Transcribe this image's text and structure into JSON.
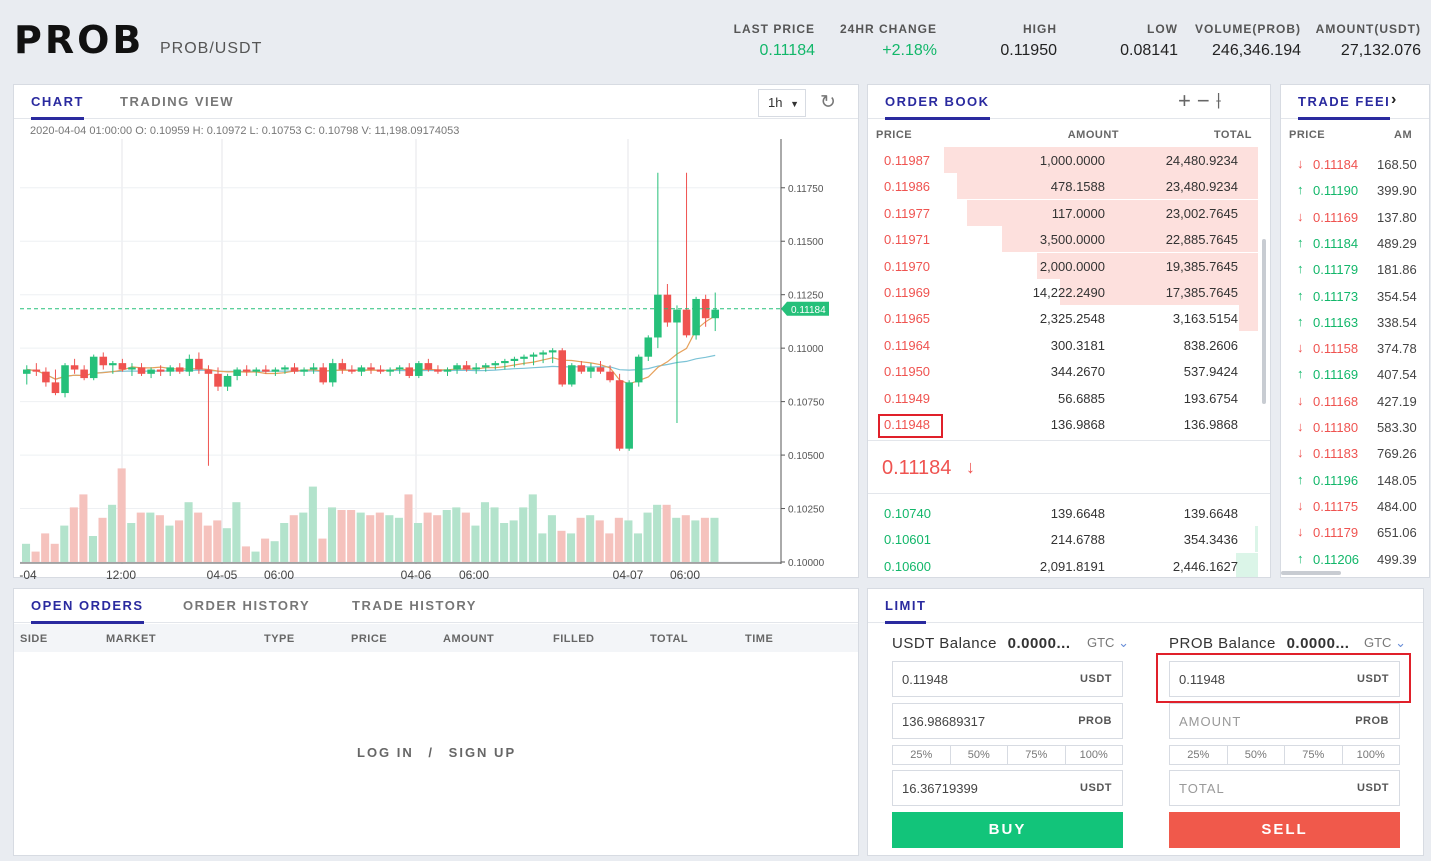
{
  "header": {
    "logo": "PROB",
    "pair": "PROB/USDT",
    "stats": [
      {
        "label": "LAST PRICE",
        "value": "0.11184"
      },
      {
        "label": "24HR CHANGE",
        "value": "+2.18%"
      },
      {
        "label": "HIGH",
        "value": "0.11950"
      },
      {
        "label": "LOW",
        "value": "0.08141"
      },
      {
        "label": "VOLUME(PROB)",
        "value": "246,346.194"
      },
      {
        "label": "AMOUNT(USDT)",
        "value": "27,132.076"
      }
    ]
  },
  "chart_panel": {
    "tabs": [
      "CHART",
      "TRADING VIEW"
    ],
    "interval": "1h",
    "info": "2020-04-04 01:00:00  O: 0.10959  H: 0.10972  L: 0.10753  C: 0.10798  V: 11,198.09174053",
    "price_tag": "0.11184",
    "y_ticks": [
      "0.11750",
      "0.11500",
      "0.11250",
      "0.11000",
      "0.10750",
      "0.10500",
      "0.10250",
      "0.10000"
    ],
    "x_ticks": [
      "-04",
      "12:00",
      "04-05",
      "06:00",
      "04-06",
      "06:00",
      "04-07",
      "06:00"
    ]
  },
  "chart_data": {
    "type": "candlestick",
    "ylim": [
      0.1,
      0.1195
    ],
    "last_price": 0.11184,
    "candles": [
      [
        0.1088,
        0.1092,
        0.1083,
        0.109
      ],
      [
        0.109,
        0.1093,
        0.1087,
        0.1089
      ],
      [
        0.1089,
        0.1091,
        0.1082,
        0.1084
      ],
      [
        0.1084,
        0.109,
        0.1078,
        0.1079
      ],
      [
        0.1079,
        0.1093,
        0.1077,
        0.1092
      ],
      [
        0.1092,
        0.1095,
        0.1088,
        0.109
      ],
      [
        0.109,
        0.1092,
        0.1085,
        0.1086
      ],
      [
        0.1086,
        0.1097,
        0.1085,
        0.1096
      ],
      [
        0.1096,
        0.1098,
        0.109,
        0.1092
      ],
      [
        0.1092,
        0.1094,
        0.1088,
        0.1093
      ],
      [
        0.1093,
        0.1095,
        0.1089,
        0.109
      ],
      [
        0.109,
        0.1093,
        0.1087,
        0.1091
      ],
      [
        0.1091,
        0.1093,
        0.1087,
        0.1088
      ],
      [
        0.1088,
        0.1091,
        0.1086,
        0.109
      ],
      [
        0.109,
        0.1092,
        0.1087,
        0.1089
      ],
      [
        0.1089,
        0.1092,
        0.1087,
        0.1091
      ],
      [
        0.1091,
        0.1093,
        0.1088,
        0.1089
      ],
      [
        0.1089,
        0.1097,
        0.1087,
        0.1095
      ],
      [
        0.1095,
        0.1098,
        0.1088,
        0.109
      ],
      [
        0.109,
        0.1092,
        0.1045,
        0.1088
      ],
      [
        0.1088,
        0.1091,
        0.108,
        0.1082
      ],
      [
        0.1082,
        0.1088,
        0.108,
        0.1087
      ],
      [
        0.1087,
        0.1091,
        0.1085,
        0.109
      ],
      [
        0.109,
        0.1092,
        0.1087,
        0.1089
      ],
      [
        0.1089,
        0.1091,
        0.1087,
        0.109
      ],
      [
        0.109,
        0.1092,
        0.1088,
        0.1089
      ],
      [
        0.1089,
        0.1091,
        0.1087,
        0.109
      ],
      [
        0.109,
        0.1092,
        0.1088,
        0.1091
      ],
      [
        0.1091,
        0.1093,
        0.1088,
        0.1089
      ],
      [
        0.1089,
        0.1091,
        0.1087,
        0.109
      ],
      [
        0.109,
        0.1093,
        0.1088,
        0.1091
      ],
      [
        0.1091,
        0.1093,
        0.1083,
        0.1084
      ],
      [
        0.1084,
        0.1095,
        0.1082,
        0.1093
      ],
      [
        0.1093,
        0.1095,
        0.1088,
        0.109
      ],
      [
        0.109,
        0.1092,
        0.1088,
        0.1089
      ],
      [
        0.1089,
        0.1092,
        0.1087,
        0.1091
      ],
      [
        0.1091,
        0.1093,
        0.1088,
        0.109
      ],
      [
        0.109,
        0.1092,
        0.1088,
        0.1089
      ],
      [
        0.1089,
        0.1091,
        0.1087,
        0.109
      ],
      [
        0.109,
        0.1092,
        0.1088,
        0.1091
      ],
      [
        0.1091,
        0.1093,
        0.1086,
        0.1087
      ],
      [
        0.1087,
        0.1094,
        0.1086,
        0.1093
      ],
      [
        0.1093,
        0.1095,
        0.1089,
        0.109
      ],
      [
        0.109,
        0.1092,
        0.1088,
        0.1089
      ],
      [
        0.1089,
        0.1091,
        0.1087,
        0.109
      ],
      [
        0.109,
        0.1093,
        0.1088,
        0.1092
      ],
      [
        0.1092,
        0.1094,
        0.1089,
        0.109
      ],
      [
        0.109,
        0.1093,
        0.1088,
        0.1091
      ],
      [
        0.1091,
        0.1093,
        0.1089,
        0.1092
      ],
      [
        0.1092,
        0.1094,
        0.109,
        0.1093
      ],
      [
        0.1093,
        0.1095,
        0.109,
        0.1094
      ],
      [
        0.1094,
        0.1096,
        0.1091,
        0.1095
      ],
      [
        0.1095,
        0.1097,
        0.1092,
        0.1096
      ],
      [
        0.1096,
        0.1098,
        0.1092,
        0.1097
      ],
      [
        0.1097,
        0.1099,
        0.1093,
        0.1098
      ],
      [
        0.1098,
        0.11,
        0.1093,
        0.1099
      ],
      [
        0.1099,
        0.11,
        0.1082,
        0.1083
      ],
      [
        0.1083,
        0.1093,
        0.1082,
        0.1092
      ],
      [
        0.1092,
        0.1094,
        0.1088,
        0.1089
      ],
      [
        0.1089,
        0.1093,
        0.1086,
        0.1091
      ],
      [
        0.1091,
        0.1094,
        0.1088,
        0.1089
      ],
      [
        0.1089,
        0.1092,
        0.1084,
        0.1085
      ],
      [
        0.1085,
        0.1088,
        0.1052,
        0.1053
      ],
      [
        0.1053,
        0.1085,
        0.1052,
        0.1084
      ],
      [
        0.1084,
        0.1097,
        0.1082,
        0.1096
      ],
      [
        0.1096,
        0.1106,
        0.1094,
        0.1105
      ],
      [
        0.1105,
        0.1182,
        0.11,
        0.1125
      ],
      [
        0.1125,
        0.113,
        0.111,
        0.1112
      ],
      [
        0.1112,
        0.112,
        0.1065,
        0.1118
      ],
      [
        0.1118,
        0.1182,
        0.1105,
        0.1106
      ],
      [
        0.1106,
        0.1124,
        0.1104,
        0.1123
      ],
      [
        0.1123,
        0.1125,
        0.111,
        0.1114
      ],
      [
        0.1114,
        0.1126,
        0.1108,
        0.1118
      ]
    ],
    "volumes": [
      7,
      4,
      11,
      7,
      14,
      21,
      26,
      10,
      17,
      22,
      36,
      15,
      19,
      19,
      18,
      14,
      16,
      23,
      19,
      14,
      16,
      13,
      23,
      6,
      4,
      9,
      8,
      15,
      18,
      19,
      29,
      9,
      21,
      20,
      20,
      19,
      18,
      19,
      18,
      17,
      26,
      15,
      19,
      18,
      20,
      21,
      19,
      14,
      23,
      21,
      15,
      16,
      21,
      26,
      11,
      18,
      12,
      11,
      17,
      18,
      16,
      11,
      17,
      16,
      11,
      19,
      22,
      22,
      17,
      18,
      16,
      17,
      17,
      9,
      17,
      14,
      18,
      15,
      13
    ]
  },
  "order_book": {
    "title": "ORDER BOOK",
    "columns": [
      "PRICE",
      "AMOUNT",
      "TOTAL"
    ],
    "asks": [
      {
        "price": "0.11987",
        "amount": "1,000.0000",
        "total": "24,480.9234",
        "depth": 0.98
      },
      {
        "price": "0.11986",
        "amount": "478.1588",
        "total": "23,480.9234",
        "depth": 0.94
      },
      {
        "price": "0.11977",
        "amount": "117.0000",
        "total": "23,002.7645",
        "depth": 0.91
      },
      {
        "price": "0.11971",
        "amount": "3,500.0000",
        "total": "22,885.7645",
        "depth": 0.8
      },
      {
        "price": "0.11970",
        "amount": "2,000.0000",
        "total": "19,385.7645",
        "depth": 0.69
      },
      {
        "price": "0.11969",
        "amount": "14,222.2490",
        "total": "17,385.7645",
        "depth": 0.62
      },
      {
        "price": "0.11965",
        "amount": "2,325.2548",
        "total": "3,163.5154",
        "depth": 0.06
      },
      {
        "price": "0.11964",
        "amount": "300.3181",
        "total": "838.2606",
        "depth": 0.0
      },
      {
        "price": "0.11950",
        "amount": "344.2670",
        "total": "537.9424",
        "depth": 0.0
      },
      {
        "price": "0.11949",
        "amount": "56.6885",
        "total": "193.6754",
        "depth": 0.0
      },
      {
        "price": "0.11948",
        "amount": "136.9868",
        "total": "136.9868",
        "depth": 0.0
      }
    ],
    "last_price": "0.11184",
    "bids": [
      {
        "price": "0.10740",
        "amount": "139.6648",
        "total": "139.6648",
        "depth": 0.0
      },
      {
        "price": "0.10601",
        "amount": "214.6788",
        "total": "354.3436",
        "depth": 0.01
      },
      {
        "price": "0.10600",
        "amount": "2,091.8191",
        "total": "2,446.1627",
        "depth": 0.07
      }
    ]
  },
  "trade_feed": {
    "title": "TRADE FEEI",
    "columns": [
      "PRICE",
      "AM"
    ],
    "trades": [
      {
        "dir": "down",
        "price": "0.11184",
        "amount": "168.50"
      },
      {
        "dir": "up",
        "price": "0.11190",
        "amount": "399.90"
      },
      {
        "dir": "down",
        "price": "0.11169",
        "amount": "137.80"
      },
      {
        "dir": "up",
        "price": "0.11184",
        "amount": "489.29"
      },
      {
        "dir": "up",
        "price": "0.11179",
        "amount": "181.86"
      },
      {
        "dir": "up",
        "price": "0.11173",
        "amount": "354.54"
      },
      {
        "dir": "up",
        "price": "0.11163",
        "amount": "338.54"
      },
      {
        "dir": "down",
        "price": "0.11158",
        "amount": "374.78"
      },
      {
        "dir": "up",
        "price": "0.11169",
        "amount": "407.54"
      },
      {
        "dir": "down",
        "price": "0.11168",
        "amount": "427.19"
      },
      {
        "dir": "down",
        "price": "0.11180",
        "amount": "583.30"
      },
      {
        "dir": "down",
        "price": "0.11183",
        "amount": "769.26"
      },
      {
        "dir": "up",
        "price": "0.11196",
        "amount": "148.05"
      },
      {
        "dir": "down",
        "price": "0.11175",
        "amount": "484.00"
      },
      {
        "dir": "down",
        "price": "0.11179",
        "amount": "651.06"
      },
      {
        "dir": "up",
        "price": "0.11206",
        "amount": "499.39"
      }
    ]
  },
  "orders": {
    "tabs": [
      "OPEN ORDERS",
      "ORDER HISTORY",
      "TRADE HISTORY"
    ],
    "columns": [
      "SIDE",
      "MARKET",
      "TYPE",
      "PRICE",
      "AMOUNT",
      "FILLED",
      "TOTAL",
      "TIME"
    ],
    "login": "LOG IN",
    "sep": "/",
    "signup": "SIGN UP"
  },
  "limit": {
    "tab": "LIMIT",
    "buy": {
      "balance_label": "USDT Balance",
      "balance_value": "0.0000...",
      "gtc": "GTC",
      "price": "0.11948",
      "price_unit": "USDT",
      "amount": "136.98689317",
      "amount_unit": "PROB",
      "total": "16.36719399",
      "total_unit": "USDT",
      "button": "BUY"
    },
    "sell": {
      "balance_label": "PROB Balance",
      "balance_value": "0.0000...",
      "gtc": "GTC",
      "price": "0.11948",
      "price_unit": "USDT",
      "amount_placeholder": "AMOUNT",
      "amount_unit": "PROB",
      "total_placeholder": "TOTAL",
      "total_unit": "USDT",
      "button": "SELL"
    },
    "percents": [
      "25%",
      "50%",
      "75%",
      "100%"
    ]
  },
  "colors": {
    "green": "#12b76a",
    "red": "#ef5350",
    "accent": "#2a2a9f"
  }
}
